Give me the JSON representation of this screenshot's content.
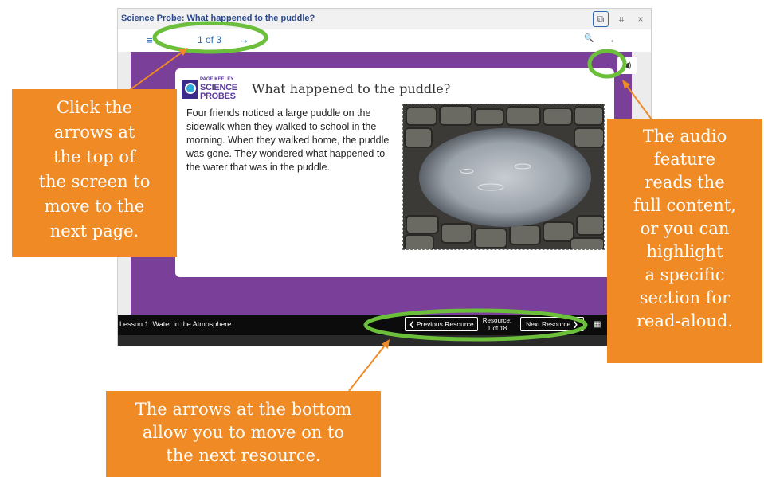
{
  "window": {
    "title": "Science Probe: What happened to the puddle?",
    "toolbar": {
      "popout_icon": "popout-icon",
      "crop_icon": "crop-icon",
      "close_icon": "close-icon",
      "popout_glyph": "⧉",
      "crop_glyph": "⌗",
      "close_glyph": "×"
    }
  },
  "navbar": {
    "menu_glyph": "≡",
    "page_indicator": "1 of 3",
    "next_arrow": "→",
    "search_glyph": "🔍",
    "back_glyph": "←"
  },
  "card": {
    "logo": {
      "small": "PAGE KEELEY",
      "line1": "SCIENCE",
      "line2": "PROBES"
    },
    "heading": "What happened to the puddle?",
    "paragraph": "Four friends noticed a large puddle on the sidewalk when they walked to school in the morning. When they walked home, the puddle was gone. They wondered what happened to the water that was in the puddle."
  },
  "audio": {
    "glyph": "◀)"
  },
  "footer": {
    "lesson": "Lesson 1: Water in the Atmosphere",
    "prev_label": "❮ Previous Resource",
    "resource_label": "Resource:",
    "resource_count": "1 of 18",
    "next_label": "Next Resource ❯",
    "grid_glyph": "▦"
  },
  "callouts": {
    "left": [
      "Click the",
      "arrows at",
      "the top of",
      "the screen to",
      "move to the",
      "next page."
    ],
    "right": [
      "The audio",
      "feature",
      "reads the",
      "full content,",
      "or you can",
      "highlight",
      "a specific",
      "section for",
      "read-aloud."
    ],
    "bottom": [
      "The arrows at the bottom",
      "allow you to move on to",
      "the next resource."
    ]
  },
  "colors": {
    "callout_orange": "#f08a24",
    "highlight_green": "#6bbf3a",
    "purple_bg": "#7a3f98",
    "link_blue": "#2b6bb0"
  }
}
